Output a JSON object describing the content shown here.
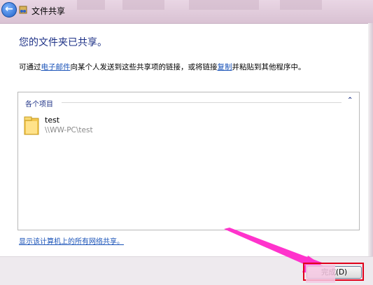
{
  "window": {
    "title": "文件共享",
    "back_icon": "back-arrow-icon"
  },
  "content": {
    "heading": "您的文件夹已共享。",
    "desc_prefix": "可通过",
    "email_link": "电子邮件",
    "desc_middle": "向某个人发送到这些共享项的链接，或将链接",
    "copy_link": "复制",
    "desc_suffix": "并粘贴到其他程序中。"
  },
  "panel": {
    "header": "各个项目",
    "items": [
      {
        "name": "test",
        "path": "\\\\WW-PC\\test",
        "icon": "folder-icon"
      }
    ]
  },
  "footer": {
    "network_link": "显示该计算机上的所有网络共享。",
    "finish_label": "完成(D)"
  },
  "colors": {
    "heading": "#1e3287",
    "link": "#1a53b8",
    "highlight_box": "#e0001a",
    "annotation_arrow": "#ff33cc"
  }
}
